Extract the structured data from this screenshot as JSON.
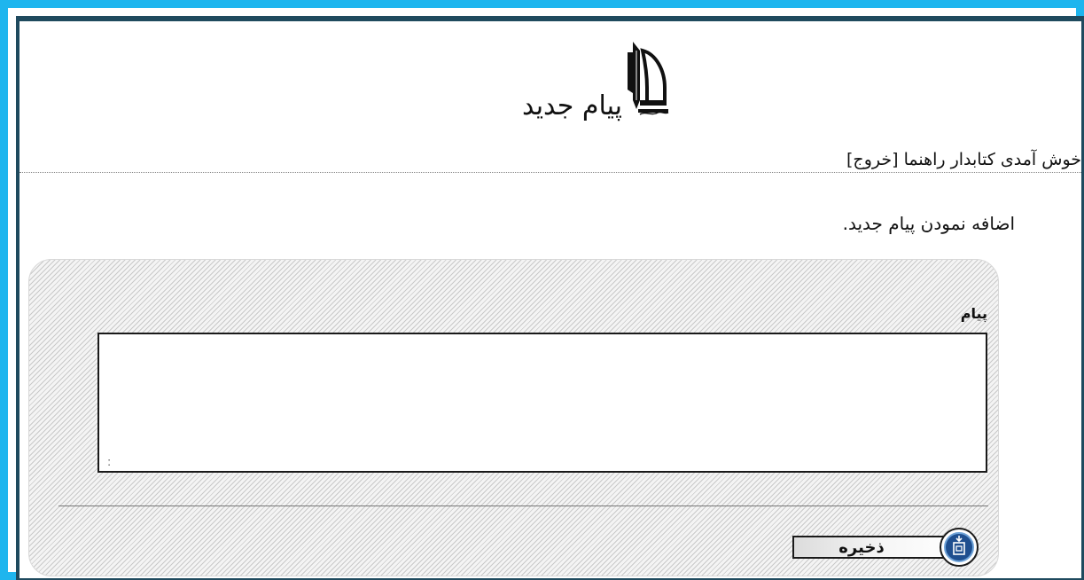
{
  "header": {
    "title": "پیام جدید",
    "logo": "university-pen-dome-logo"
  },
  "user_bar": {
    "welcome_text": "خوش آمدی کتابدار راهنما",
    "logout_link": "[خروج]"
  },
  "page": {
    "subtitle": "اضافه نمودن پیام جدید."
  },
  "form": {
    "message_label": "پیام",
    "message_value": "",
    "save_label": "ذخیره",
    "save_icon": "save-disk-icon"
  },
  "colors": {
    "outer_border": "#1eb5ee",
    "inner_border": "#1f4a5e",
    "save_icon_fill": "#1f4f8f"
  }
}
